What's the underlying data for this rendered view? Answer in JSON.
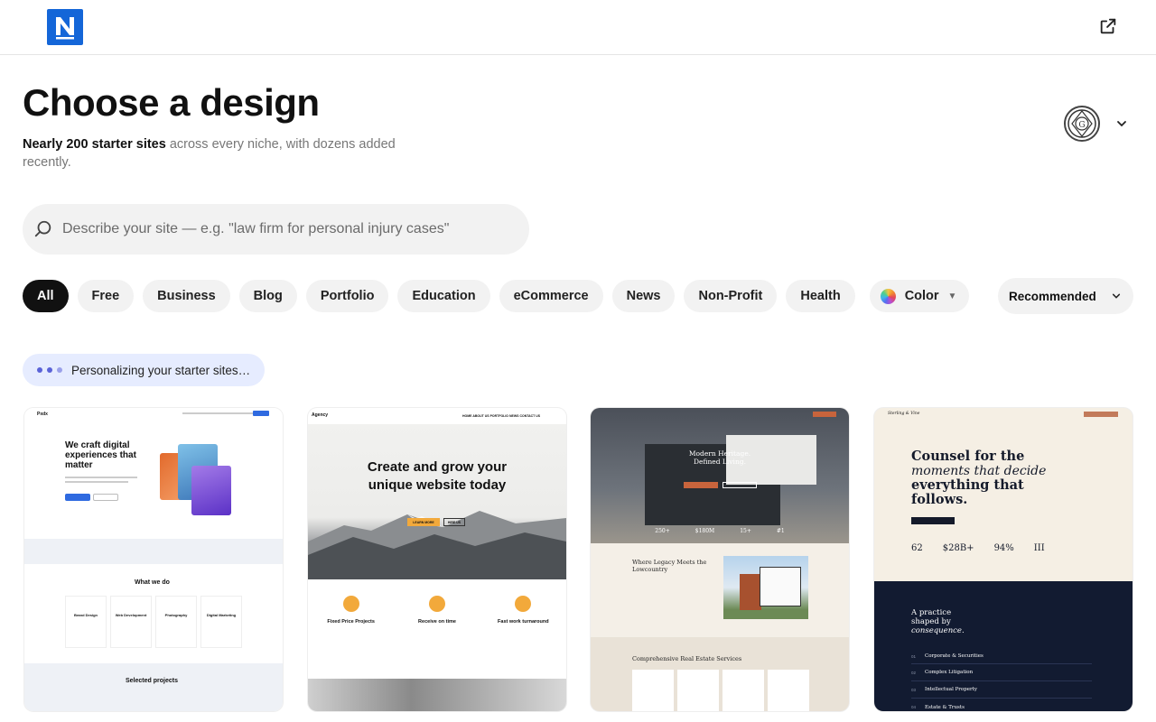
{
  "header": {
    "logo_icon": "n-logo-icon",
    "external_link_icon": "external-link-icon"
  },
  "hero": {
    "title": "Choose a design",
    "subtitle_bold": "Nearly 200 starter sites",
    "subtitle_rest": " across every niche, with dozens added recently."
  },
  "account": {
    "avatar_icon": "seal-avatar-icon",
    "chevron_icon": "chevron-down-icon"
  },
  "search": {
    "placeholder": "Describe your site — e.g. \"law firm for personal injury cases\"",
    "icon": "search-icon"
  },
  "filters": {
    "chips": [
      "All",
      "Free",
      "Business",
      "Blog",
      "Portfolio",
      "Education",
      "eCommerce",
      "News",
      "Non-Profit",
      "Health"
    ],
    "active": "All",
    "color_label": "Color",
    "sort_label": "Recommended"
  },
  "status": {
    "personalizing": "Personalizing your starter sites…"
  },
  "cards": {
    "c1": {
      "brand": "Pxdx",
      "headline": "We craft digital experiences that matter",
      "what": "What we do",
      "services": [
        "Brand Design",
        "Web Development",
        "Photography",
        "Digital Marketing"
      ],
      "selected": "Selected projects"
    },
    "c2": {
      "brand": "Agency",
      "nav": "HOME   ABOUT US   PORTFOLIO   NEWS   CONTACT US",
      "headline": "Create and grow your unique website today",
      "btn1": "LEARN MORE",
      "btn2": "HIRE US",
      "features": [
        "Fixed Price Projects",
        "Receive on time",
        "Fast work turnaround"
      ]
    },
    "c3": {
      "headline": "Modern Heritage. Defined Living.",
      "stats": [
        "250+",
        "$180M",
        "15+",
        "#1"
      ],
      "section": "Where Legacy Meets the Lowcountry",
      "services_title": "Comprehensive Real Estate Services"
    },
    "c4": {
      "brand": "Sterling & Vine",
      "headline_a": "Counsel for the",
      "headline_b": "moments that decide",
      "headline_c": "everything that follows.",
      "stats": [
        "62",
        "$28B+",
        "94%",
        "III"
      ],
      "practice_a": "A practice",
      "practice_b": "shaped by",
      "practice_c": "consequence.",
      "areas": [
        "Corporate & Securities",
        "Complex Litigation",
        "Intellectual Property",
        "Estate & Trusts"
      ],
      "area_numbers": [
        "01",
        "02",
        "03",
        "04"
      ]
    }
  },
  "colors": {
    "accent": "#1466d8",
    "chip_bg": "#f2f2f2",
    "active_chip": "#111111",
    "status_bg": "#e6ecff"
  }
}
